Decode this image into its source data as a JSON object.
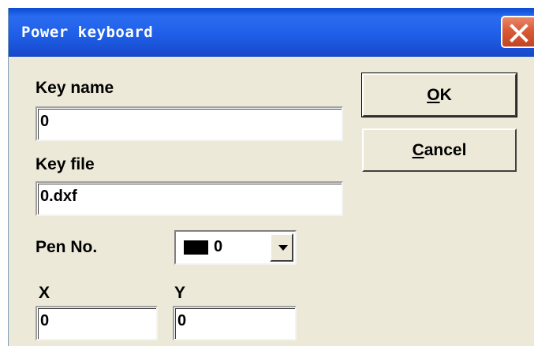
{
  "window": {
    "title": "Power keyboard"
  },
  "form": {
    "key_name_label": "Key name",
    "key_name_value": "0",
    "key_file_label": "Key file",
    "key_file_value": "0.dxf",
    "pen_label": "Pen No.",
    "pen_value": "0",
    "pen_color": "#000000",
    "x_label": "X",
    "x_value": "0",
    "y_label": "Y",
    "y_value": "0"
  },
  "buttons": {
    "ok_mnemonic": "O",
    "ok_rest": "K",
    "cancel_mnemonic": "C",
    "cancel_rest": "ancel"
  },
  "icons": {
    "close": "close-icon",
    "dropdown": "chevron-down-icon"
  },
  "colors": {
    "titlebar": "#1f5fe8",
    "close_button": "#d85a36",
    "dialog_bg": "#ece9d8"
  }
}
